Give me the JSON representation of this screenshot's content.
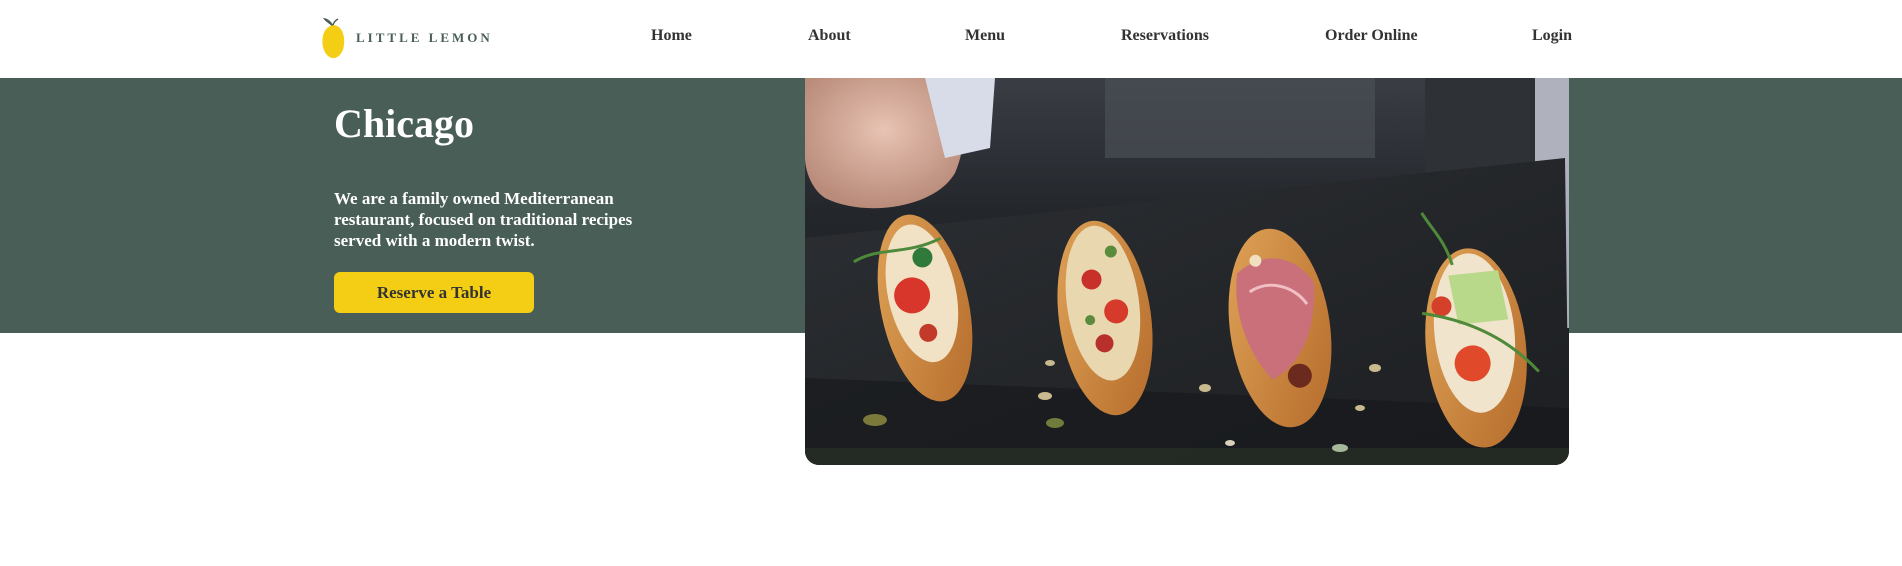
{
  "brand": {
    "name": "LITTLE LEMON",
    "logo_icon": "lemon-icon",
    "colors": {
      "primary_green": "#495e57",
      "primary_yellow": "#f4ce14",
      "text_dark": "#333333",
      "white": "#ffffff"
    }
  },
  "nav": {
    "items": [
      {
        "label": "Home"
      },
      {
        "label": "About"
      },
      {
        "label": "Menu"
      },
      {
        "label": "Reservations"
      },
      {
        "label": "Order Online"
      },
      {
        "label": "Login"
      }
    ]
  },
  "hero": {
    "title": "Chicago",
    "description": "We are a family owned Mediterranean restaurant, focused on traditional recipes served with a modern twist.",
    "cta_label": "Reserve a Table",
    "image": "bruschetta-appetizers-photo"
  }
}
